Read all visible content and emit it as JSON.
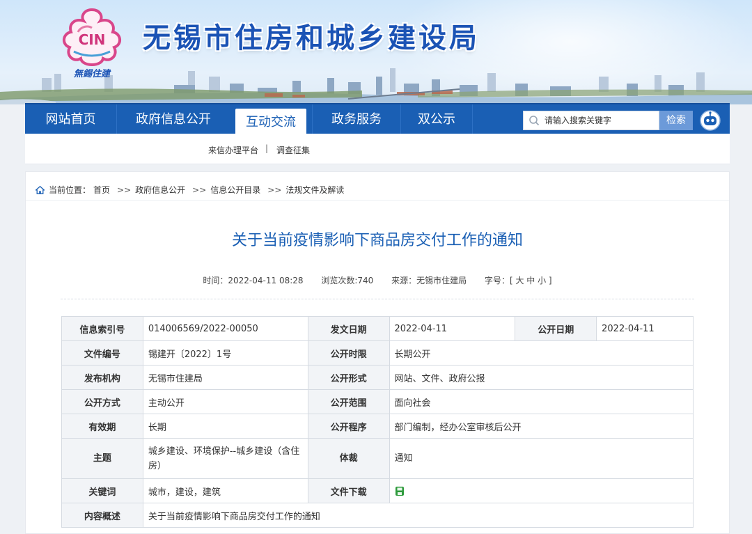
{
  "site": {
    "title": "无锡市住房和城乡建设局",
    "logo_text": "CIN",
    "logo_subtitle": "無錫住建"
  },
  "nav": {
    "items": [
      {
        "label": "网站首页",
        "active": false
      },
      {
        "label": "政府信息公开",
        "active": false
      },
      {
        "label": "互动交流",
        "active": true
      },
      {
        "label": "政务服务",
        "active": false
      },
      {
        "label": "双公示",
        "active": false
      }
    ],
    "search_placeholder": "请输入搜索关键字",
    "search_button": "检索"
  },
  "subnav": {
    "item1": "来信办理平台",
    "separator": "|",
    "item2": "调查征集"
  },
  "breadcrumb": {
    "prefix": "当前位置：",
    "items": [
      "首页",
      "政府信息公开",
      "信息公开目录",
      "法规文件及解读"
    ],
    "sep": ">>"
  },
  "article": {
    "title": "关于当前疫情影响下商品房交付工作的通知",
    "time": "时间：2022-04-11 08:28",
    "views": "浏览次数:740",
    "source": "来源：无锡市住建局",
    "fontsize": "字号：[ 大 中 小 ]"
  },
  "info_table": {
    "index_label": "信息索引号",
    "index_value": "014006569/2022-00050",
    "issue_date_label": "发文日期",
    "issue_date_value": "2022-04-11",
    "public_date_label": "公开日期",
    "public_date_value": "2022-04-11",
    "doc_no_label": "文件编号",
    "doc_no_value": "锡建开〔2022〕1号",
    "limit_label": "公开时限",
    "limit_value": "长期公开",
    "org_label": "发布机构",
    "org_value": "无锡市住建局",
    "form_label": "公开形式",
    "form_value": "网站、文件、政府公报",
    "method_label": "公开方式",
    "method_value": "主动公开",
    "scope_label": "公开范围",
    "scope_value": "面向社会",
    "validity_label": "有效期",
    "validity_value": "长期",
    "procedure_label": "公开程序",
    "procedure_value": "部门编制，经办公室审核后公开",
    "topic_label": "主题",
    "topic_value": "城乡建设、环境保护--城乡建设（含住房）",
    "genre_label": "体裁",
    "genre_value": "通知",
    "keywords_label": "关键词",
    "keywords_value": "城市，建设，建筑",
    "download_label": "文件下载",
    "summary_label": "内容概述",
    "summary_value": "关于当前疫情影响下商品房交付工作的通知"
  },
  "colors": {
    "brand_blue": "#1a5fb4",
    "title_blue": "#1b53b5",
    "download_green": "#2e9a3c"
  }
}
